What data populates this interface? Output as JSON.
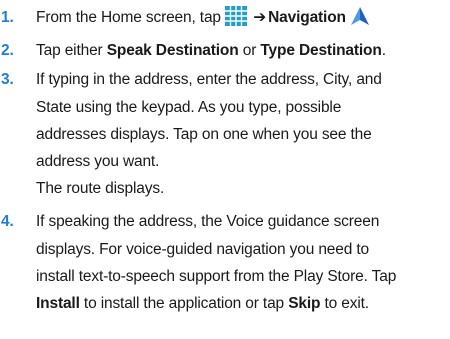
{
  "steps": [
    {
      "number": "1.",
      "segments": {
        "a": "From the Home screen, tap",
        "arrow": "➔",
        "b": "Navigation"
      }
    },
    {
      "number": "2.",
      "segments": {
        "a": "Tap either ",
        "b": "Speak Destination",
        "c": " or ",
        "d": "Type Destination",
        "e": "."
      }
    },
    {
      "number": "3.",
      "lines": [
        "If typing in the address, enter the address, City, and",
        "State using the keypad. As you type, possible",
        "addresses displays. Tap on one when you see the",
        "address you want."
      ],
      "result": "The route displays."
    },
    {
      "number": "4.",
      "lines": [
        "If speaking the address, the Voice guidance screen",
        "displays. For voice-guided navigation you need to",
        "install text-to-speech support from the Play Store. Tap"
      ],
      "last": {
        "a": "Install",
        "b": " to install the application or tap ",
        "c": "Skip",
        "d": " to exit."
      }
    }
  ],
  "colors": {
    "accent": "#1f7fd3",
    "apps_icon": "#1fa0c8",
    "navigation_icon": "#1e5fc0"
  },
  "icons": {
    "apps": "apps-grid-icon",
    "navigation": "navigation-arrow-icon"
  }
}
